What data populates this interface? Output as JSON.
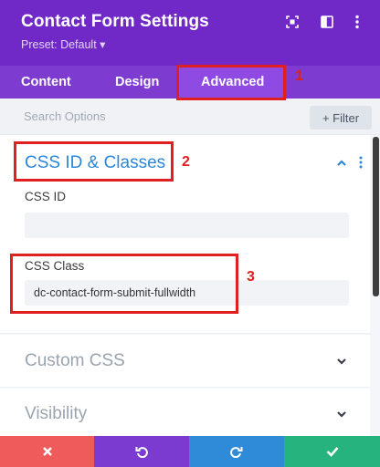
{
  "header": {
    "title": "Contact Form Settings",
    "preset": "Preset: Default ▾",
    "icons": [
      "focus-icon",
      "sidebar-toggle-icon",
      "more-vertical-icon"
    ]
  },
  "tabs": [
    {
      "label": "Content",
      "active": false
    },
    {
      "label": "Design",
      "active": false
    },
    {
      "label": "Advanced",
      "active": true
    }
  ],
  "search": {
    "placeholder": "Search Options",
    "filter_label": "+ Filter"
  },
  "sections": {
    "css_id_classes": {
      "title": "CSS ID & Classes",
      "expanded": true,
      "css_id_label": "CSS ID",
      "css_id_value": "",
      "css_class_label": "CSS Class",
      "css_class_value": "dc-contact-form-submit-fullwidth"
    },
    "custom_css": {
      "title": "Custom CSS",
      "expanded": false
    },
    "visibility": {
      "title": "Visibility",
      "expanded": false
    }
  },
  "annotations": {
    "n1": "1",
    "n2": "2",
    "n3": "3"
  },
  "footer": {
    "buttons": [
      {
        "name": "discard",
        "icon": "close-icon",
        "color": "#ef5b5b"
      },
      {
        "name": "undo",
        "icon": "undo-icon",
        "color": "#7b3ad0"
      },
      {
        "name": "redo",
        "icon": "redo-icon",
        "color": "#2f8ad8"
      },
      {
        "name": "save",
        "icon": "check-icon",
        "color": "#27b37e"
      }
    ]
  },
  "colors": {
    "header": "#7029c7",
    "tabs": "#7e3bd0",
    "active_tab": "#8f4ae3",
    "accent": "#2b87da",
    "annotation": "#e02020"
  }
}
